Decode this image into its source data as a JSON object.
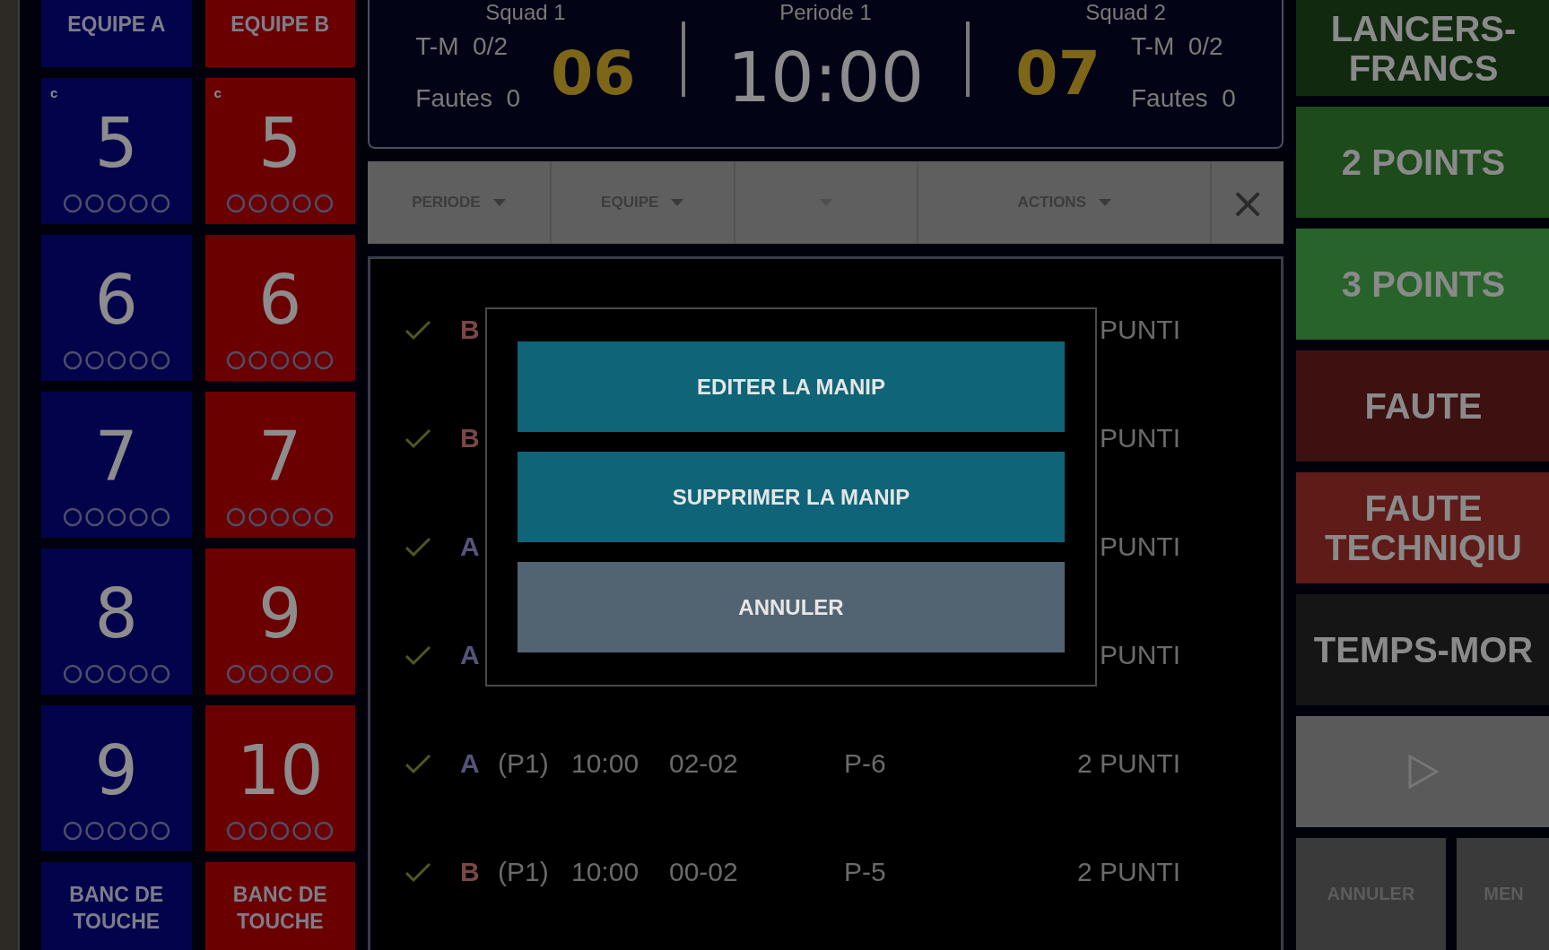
{
  "teams": [
    {
      "name": "EQUIPE A",
      "players": [
        {
          "number": "5",
          "captain_mark": "c"
        },
        {
          "number": "6"
        },
        {
          "number": "7"
        },
        {
          "number": "8"
        },
        {
          "number": "9"
        }
      ],
      "bench": "BANC DE TOUCHE"
    },
    {
      "name": "EQUIPE B",
      "players": [
        {
          "number": "5",
          "captain_mark": "c"
        },
        {
          "number": "6"
        },
        {
          "number": "7"
        },
        {
          "number": "9"
        },
        {
          "number": "10"
        }
      ],
      "bench": "BANC DE TOUCHE"
    }
  ],
  "scoreboard": {
    "home": {
      "name": "Squad 1",
      "timeouts_label": "T-M",
      "timeouts": "0/2",
      "fouls_label": "Fautes",
      "fouls": "0",
      "score": "06"
    },
    "period": "Periode 1",
    "clock": "10:00",
    "away": {
      "name": "Squad 2",
      "timeouts_label": "T-M",
      "timeouts": "0/2",
      "fouls_label": "Fautes",
      "fouls": "0",
      "score": "07"
    }
  },
  "filters": [
    {
      "label": "PERIODE",
      "disabled": false
    },
    {
      "label": "EQUIPE",
      "disabled": false
    },
    {
      "disabled": true
    },
    {
      "label": "ACTIONS",
      "disabled": false
    }
  ],
  "close": "×",
  "events": [
    {
      "team": "B",
      "color": "#7a4646",
      "points": "PUNTI"
    },
    {
      "team": "B",
      "color": "#7a4646",
      "points": "PUNTI"
    },
    {
      "team": "A",
      "color": "#54547a",
      "points": "PUNTI"
    },
    {
      "team": "A",
      "color": "#54547a",
      "points": "PUNTI"
    },
    {
      "team": "A",
      "color": "#54547a",
      "period": "(P1)",
      "time": "10:00",
      "score": "02-02",
      "player": "P-6",
      "points": "2 PUNTI"
    },
    {
      "team": "B",
      "color": "#7a4646",
      "period": "(P1)",
      "time": "10:00",
      "score": "00-02",
      "player": "P-5",
      "points": "2 PUNTI"
    }
  ],
  "modal": {
    "buttons": [
      {
        "label": "EDITER LA MANIP",
        "kind": "primary"
      },
      {
        "label": "SUPPRIMER LA MANIP",
        "kind": "primary"
      },
      {
        "label": "ANNULER",
        "kind": "secondary"
      }
    ]
  },
  "actions": [
    {
      "label": "LANCERS-FRANCS",
      "kind": "green-dark"
    },
    {
      "label": "2 POINTS",
      "kind": "green"
    },
    {
      "label": "3 POINTS",
      "kind": "green-light"
    },
    {
      "label": "FAUTE",
      "kind": "red-dark"
    },
    {
      "label": "FAUTE TECHNIQIU",
      "kind": "red"
    },
    {
      "label": "TEMPS-MOR",
      "kind": "grey"
    },
    {
      "kind": "play"
    }
  ],
  "bottom_buttons": [
    "ANNULER",
    "MEN"
  ]
}
